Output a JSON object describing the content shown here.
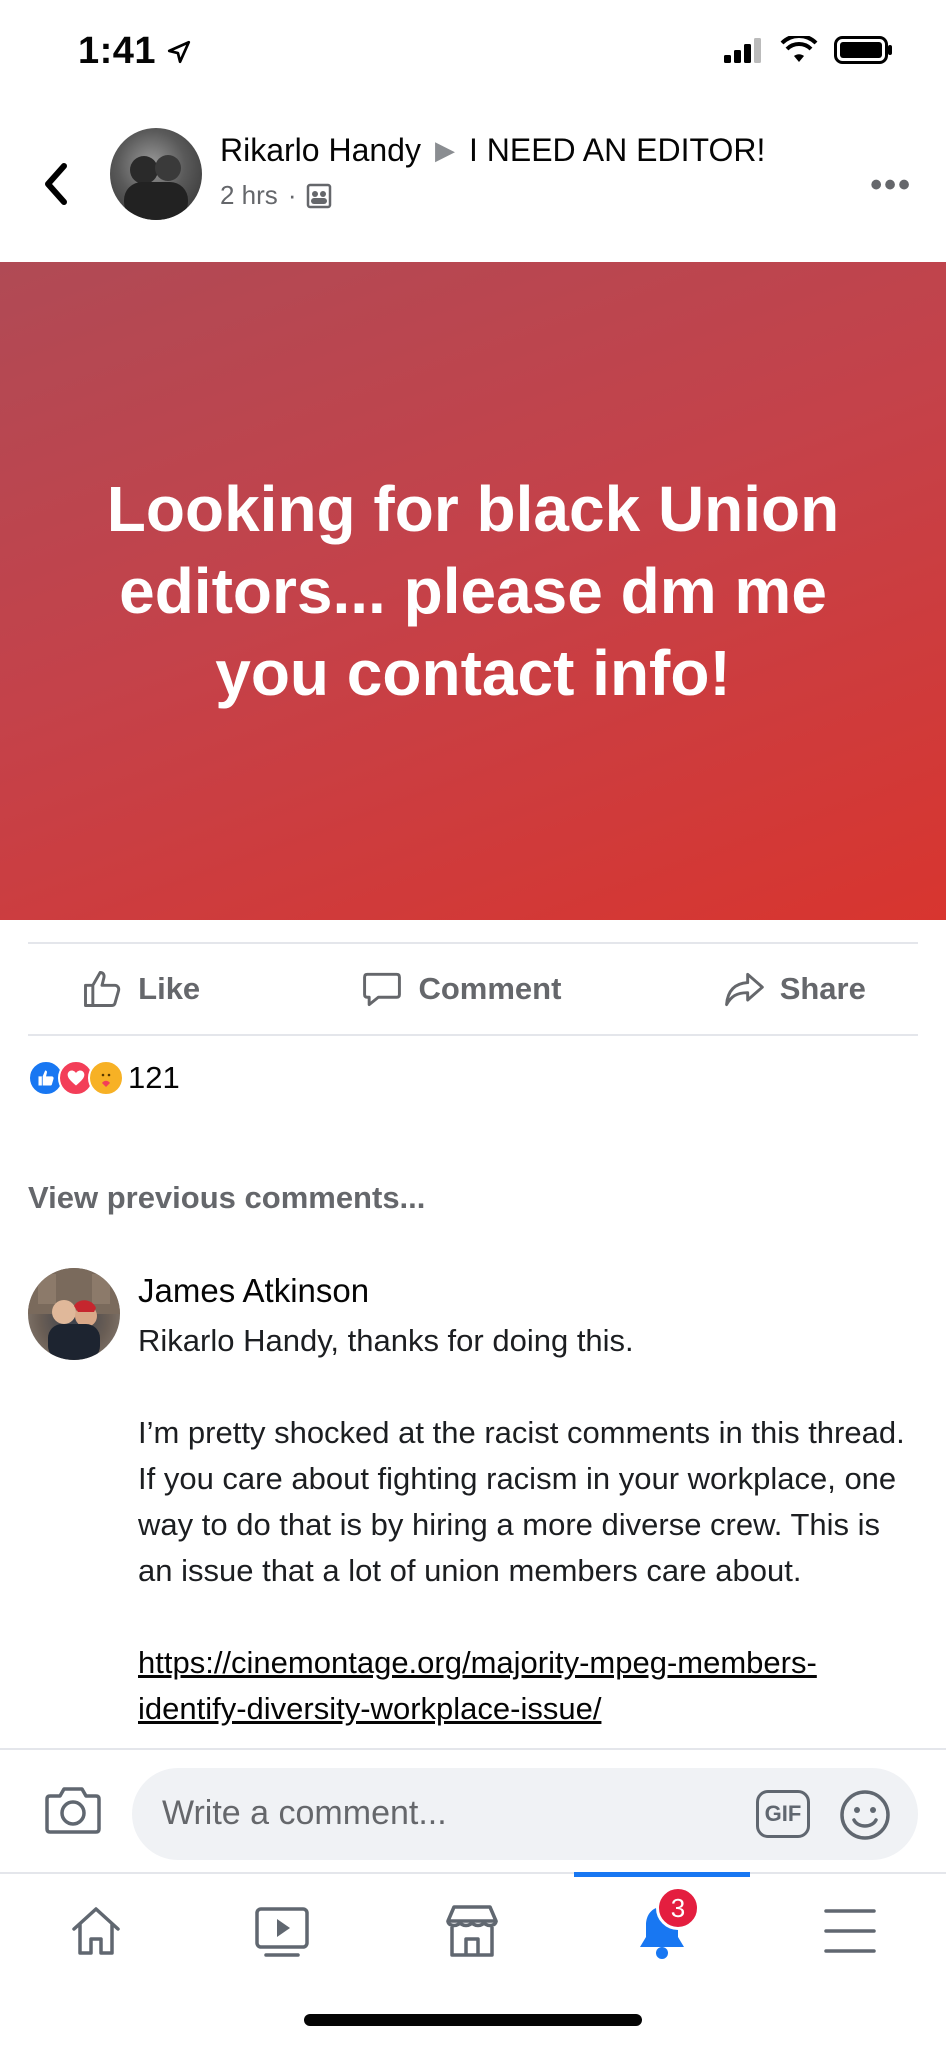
{
  "status_bar": {
    "time": "1:41"
  },
  "post": {
    "author": "Rikarlo Handy",
    "group": "I NEED AN EDITOR!",
    "time": "2 hrs",
    "dot": "·",
    "banner_text": "Looking for black Union editors... please dm me you contact info!",
    "banner_colors": [
      "#b04a55",
      "#d8352f"
    ]
  },
  "actions": {
    "like": "Like",
    "comment": "Comment",
    "share": "Share"
  },
  "reactions": {
    "count": "121",
    "icons": [
      "like-icon",
      "love-icon",
      "care-icon"
    ]
  },
  "comments": {
    "view_previous": "View previous comments...",
    "items": [
      {
        "author": "James Atkinson",
        "paragraph1": "Rikarlo Handy, thanks for doing this.",
        "paragraph2": "I’m pretty shocked at the racist comments in this thread. If you care about fighting racism in your workplace, one way to do that is by hiring a more diverse crew. This is an issue that a lot of union members care about.",
        "link": "https://cinemontage.org/majority-mpeg-members-identify-diversity-workplace-issue/"
      }
    ]
  },
  "composer": {
    "placeholder": "Write a comment...",
    "gif_label": "GIF"
  },
  "tabbar": {
    "notifications_badge": "3",
    "accent": "#1877f2"
  }
}
